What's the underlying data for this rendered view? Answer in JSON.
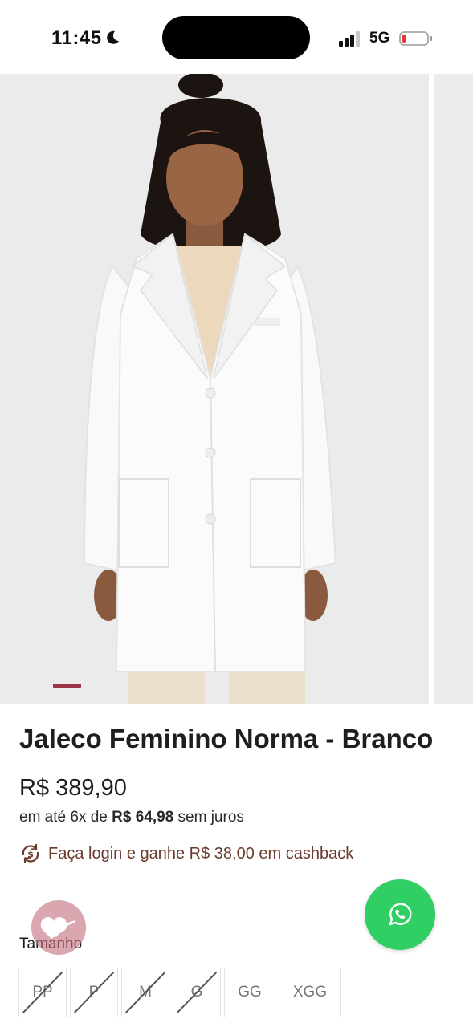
{
  "status_bar": {
    "time": "11:45",
    "network": "5G",
    "icons": [
      "moon-icon",
      "signal-icon",
      "battery-icon"
    ],
    "battery_color": "#e53935"
  },
  "gallery": {
    "image": "product-photo-white-lab-coat",
    "active_indicator_color": "#9c3346"
  },
  "product": {
    "title": "Jaleco Feminino Norma - Branco",
    "price": "R$ 389,90",
    "installments_prefix": "em até 6x de",
    "installment_value": "R$ 64,98",
    "installments_suffix": "sem juros",
    "cashback_icon": "cashback-cycle-icon",
    "cashback_text": "Faça login e ganhe R$ 38,00 em cashback",
    "cashback_color": "#6b3a2c"
  },
  "sizes": {
    "label": "Tamanho",
    "options": [
      {
        "label": "PP",
        "available": false
      },
      {
        "label": "P",
        "available": false
      },
      {
        "label": "M",
        "available": false
      },
      {
        "label": "G",
        "available": false
      },
      {
        "label": "GG",
        "available": true
      },
      {
        "label": "XGG",
        "available": true
      }
    ]
  },
  "floating": {
    "whatsapp_icon": "whatsapp-icon",
    "whatsapp_color": "#2fcf63",
    "favorite_icon": "heart-favorite-icon"
  }
}
